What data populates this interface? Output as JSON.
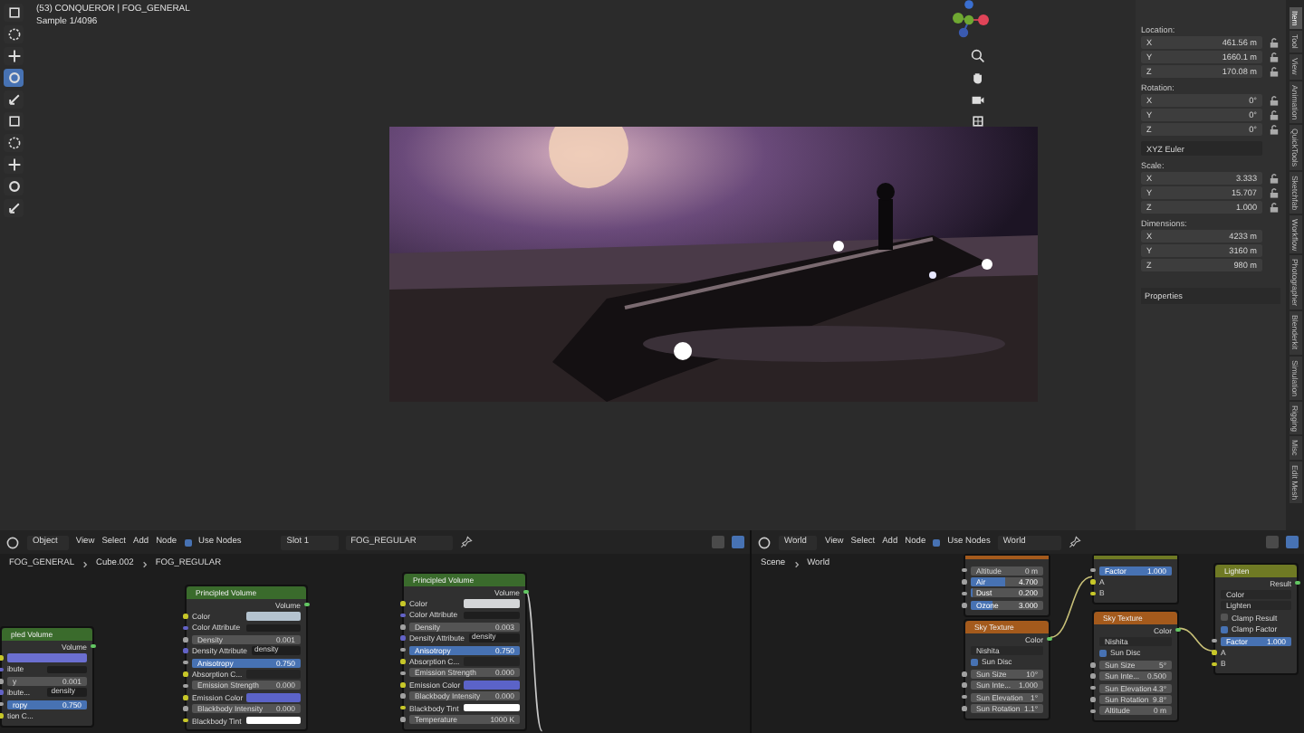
{
  "viewport": {
    "overlay_lines": [
      "(53) CONQUEROR | FOG_GENERAL",
      "Sample 1/4096"
    ],
    "tools": [
      {
        "selected": false
      },
      {
        "selected": false
      },
      {
        "selected": false
      },
      {
        "selected": true
      },
      {
        "selected": false
      },
      {
        "selected": false
      },
      {
        "selected": false
      },
      {
        "selected": false
      },
      {
        "selected": false
      },
      {
        "selected": false
      }
    ],
    "render": {
      "kind": "picture"
    }
  },
  "n_panel": {
    "sections": [
      {
        "label": "Location:",
        "locks": true,
        "rows": [
          {
            "axis": "X",
            "value": "461.56 m"
          },
          {
            "axis": "Y",
            "value": "1660.1 m"
          },
          {
            "axis": "Z",
            "value": "170.08 m"
          }
        ]
      },
      {
        "label": "Rotation:",
        "locks": true,
        "rows": [
          {
            "axis": "X",
            "value": "0°"
          },
          {
            "axis": "Y",
            "value": "0°"
          },
          {
            "axis": "Z",
            "value": "0°"
          }
        ],
        "mode": "XYZ Euler"
      },
      {
        "label": "Scale:",
        "locks": true,
        "rows": [
          {
            "axis": "X",
            "value": "3.333"
          },
          {
            "axis": "Y",
            "value": "15.707"
          },
          {
            "axis": "Z",
            "value": "1.000"
          }
        ]
      },
      {
        "label": "Dimensions:",
        "locks": false,
        "rows": [
          {
            "axis": "X",
            "value": "4233 m"
          },
          {
            "axis": "Y",
            "value": "3160 m"
          },
          {
            "axis": "Z",
            "value": "980 m"
          }
        ]
      }
    ],
    "subpanel": "Properties"
  },
  "tabs": [
    {
      "label": "Item",
      "selected": true
    },
    {
      "label": "Tool",
      "selected": false
    },
    {
      "label": "View",
      "selected": false
    },
    {
      "label": "Animation",
      "selected": false
    },
    {
      "label": "QuickTools",
      "selected": false
    },
    {
      "label": "Sketchfab",
      "selected": false
    },
    {
      "label": "Workflow",
      "selected": false
    },
    {
      "label": "Photographer",
      "selected": false
    },
    {
      "label": "Blenderkit",
      "selected": false
    },
    {
      "label": "Simulation",
      "selected": false
    },
    {
      "label": "Rigging",
      "selected": false
    },
    {
      "label": "Misc",
      "selected": false
    },
    {
      "label": "Edit Mesh",
      "selected": false
    }
  ],
  "left_editor": {
    "header": {
      "mode": "Object",
      "menus": [
        "View",
        "Select",
        "Add",
        "Node"
      ],
      "use_nodes": {
        "label": "Use Nodes",
        "checked": true
      },
      "slot": "Slot 1",
      "material": "FOG_REGULAR"
    },
    "breadcrumb": [
      "FOG_GENERAL",
      "Cube.002",
      "FOG_REGULAR"
    ],
    "nodes": [
      {
        "title": "pled Volume",
        "kind": "shader",
        "rows": [
          {
            "kind": "output",
            "label": "Volume"
          },
          {
            "kind": "color",
            "label": "",
            "color": "#6b6fd0"
          },
          {
            "kind": "attr",
            "label": "ibute",
            "value": ""
          },
          {
            "kind": "field",
            "label": "y",
            "value": "0.001"
          },
          {
            "kind": "attr",
            "label": "ibute...",
            "value": "density"
          },
          {
            "kind": "slider",
            "label": "ropy",
            "value": "0.750",
            "level": 1
          },
          {
            "kind": "input",
            "label": "tion C..."
          }
        ]
      },
      {
        "title": "Principled Volume",
        "kind": "shader",
        "rows": [
          {
            "kind": "output",
            "label": "Volume"
          },
          {
            "kind": "color",
            "label": "Color",
            "color": "#b4c3cf"
          },
          {
            "kind": "attr",
            "label": "Color Attribute",
            "value": ""
          },
          {
            "kind": "field",
            "label": "Density",
            "value": "0.001"
          },
          {
            "kind": "attr",
            "label": "Density Attribute",
            "value": "density"
          },
          {
            "kind": "slider",
            "label": "Anisotropy",
            "value": "0.750",
            "level": 1
          },
          {
            "kind": "color",
            "label": "Absorption C...",
            "color": "#242424"
          },
          {
            "kind": "field",
            "label": "Emission Strength",
            "value": "0.000"
          },
          {
            "kind": "color",
            "label": "Emission Color",
            "color": "#5b63c8"
          },
          {
            "kind": "field",
            "label": "Blackbody Intensity",
            "value": "0.000"
          },
          {
            "kind": "color",
            "label": "Blackbody Tint",
            "color": "#ffffff"
          }
        ]
      },
      {
        "title": "Principled Volume",
        "kind": "shader",
        "rows": [
          {
            "kind": "output",
            "label": "Volume"
          },
          {
            "kind": "color",
            "label": "Color",
            "color": "#d4d6d8"
          },
          {
            "kind": "attr",
            "label": "Color Attribute",
            "value": ""
          },
          {
            "kind": "field",
            "label": "Density",
            "value": "0.003"
          },
          {
            "kind": "attr",
            "label": "Density Attribute",
            "value": "density"
          },
          {
            "kind": "slider",
            "label": "Anisotropy",
            "value": "0.750",
            "level": 1
          },
          {
            "kind": "color",
            "label": "Absorption C...",
            "color": "#242424"
          },
          {
            "kind": "field",
            "label": "Emission Strength",
            "value": "0.000"
          },
          {
            "kind": "color",
            "label": "Emission Color",
            "color": "#5b63c8"
          },
          {
            "kind": "field",
            "label": "Blackbody Intensity",
            "value": "0.000"
          },
          {
            "kind": "color",
            "label": "Blackbody Tint",
            "color": "#ffffff"
          },
          {
            "kind": "field",
            "label": "Temperature",
            "value": "1000 K"
          }
        ]
      }
    ]
  },
  "right_editor": {
    "header": {
      "mode": "World",
      "menus": [
        "View",
        "Select",
        "Add",
        "Node"
      ],
      "use_nodes": {
        "label": "Use Nodes",
        "checked": true
      },
      "world": "World"
    },
    "breadcrumb": [
      "Scene",
      "World"
    ],
    "nodes": [
      {
        "kind": "texture",
        "rows": [
          {
            "kind": "field",
            "label": "Altitude",
            "value": "0 m"
          },
          {
            "kind": "slider",
            "label": "Air",
            "value": "4.700",
            "level": 0.47
          },
          {
            "kind": "slider",
            "label": "Dust",
            "value": "0.200",
            "level": 0.02
          },
          {
            "kind": "slider",
            "label": "Ozone",
            "value": "3.000",
            "level": 0.3
          }
        ]
      },
      {
        "title": "Sky Texture",
        "kind": "texture",
        "rows": [
          {
            "kind": "output",
            "label": "Color"
          },
          {
            "kind": "dropdown",
            "label": "Nishita"
          },
          {
            "kind": "check",
            "label": "Sun Disc",
            "checked": true
          },
          {
            "kind": "field",
            "label": "Sun Size",
            "value": "10°"
          },
          {
            "kind": "field",
            "label": "Sun Inte...",
            "value": "1.000"
          },
          {
            "kind": "field",
            "label": "Sun Elevation",
            "value": "1°"
          },
          {
            "kind": "field",
            "label": "Sun Rotation",
            "value": "1.1°"
          }
        ]
      },
      {
        "kind": "color",
        "rows": [
          {
            "kind": "slider",
            "label": "Factor",
            "value": "1.000",
            "level": 1
          },
          {
            "kind": "input",
            "label": "A"
          },
          {
            "kind": "input",
            "label": "B"
          }
        ]
      },
      {
        "title": "Sky Texture",
        "kind": "texture",
        "rows": [
          {
            "kind": "output",
            "label": "Color"
          },
          {
            "kind": "dropdown",
            "label": "Nishita"
          },
          {
            "kind": "check",
            "label": "Sun Disc",
            "checked": true
          },
          {
            "kind": "field",
            "label": "Sun Size",
            "value": "5°"
          },
          {
            "kind": "field",
            "label": "Sun Inte...",
            "value": "0.500"
          },
          {
            "kind": "field",
            "label": "Sun Elevation",
            "value": "4.3°"
          },
          {
            "kind": "field",
            "label": "Sun Rotation",
            "value": "9.8°"
          },
          {
            "kind": "field",
            "label": "Altitude",
            "value": "0 m"
          }
        ]
      },
      {
        "title": "Lighten",
        "kind": "color",
        "rows": [
          {
            "kind": "output",
            "label": "Result"
          },
          {
            "kind": "dropdown",
            "label": "Color"
          },
          {
            "kind": "dropdown",
            "label": "Lighten"
          },
          {
            "kind": "check",
            "label": "Clamp Result",
            "checked": false
          },
          {
            "kind": "check",
            "label": "Clamp Factor",
            "checked": true
          },
          {
            "kind": "slider",
            "label": "Factor",
            "value": "1.000",
            "level": 1
          },
          {
            "kind": "input",
            "label": "A"
          },
          {
            "kind": "input",
            "label": "B"
          }
        ]
      }
    ]
  }
}
